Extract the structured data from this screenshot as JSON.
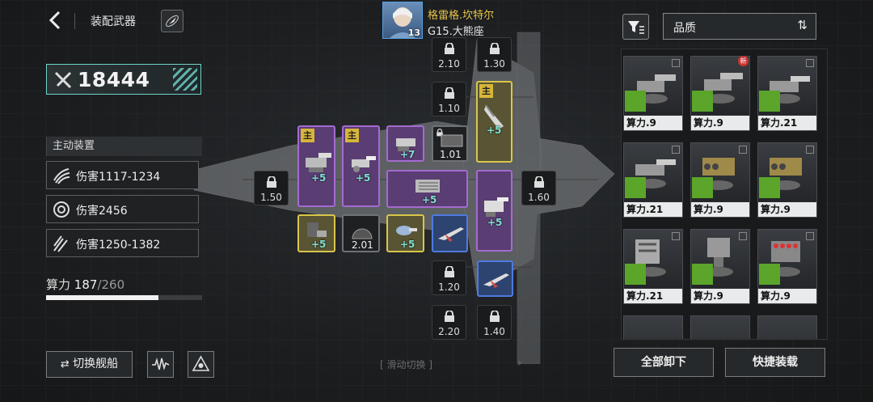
{
  "header": {
    "title": "装配武器",
    "pilot_name": "格雷格.坎特尔",
    "pilot_level": "13",
    "ship_name": "G15.大熊座"
  },
  "power": {
    "value": "18444"
  },
  "active_device": {
    "title": "主动装置",
    "stats": [
      "伤害1117-1234",
      "伤害2456",
      "伤害1250-1382"
    ]
  },
  "compute": {
    "label": "算力",
    "used": "187",
    "max": "/260",
    "fraction": 0.719
  },
  "buttons": {
    "switch_ship": "切换舰船",
    "unequip_all": "全部卸下",
    "quick_equip": "快捷装载",
    "swipe_hint": "滑动切换"
  },
  "filter": {
    "sort_label": "品质"
  },
  "slots": {
    "locked": [
      "2.10",
      "1.30",
      "1.10",
      "1.50",
      "1.60",
      "1.20",
      "2.20",
      "1.40"
    ],
    "main_tag": "主",
    "plus": "+5",
    "plus7": "+7",
    "num_101": "1.01",
    "num_201": "2.01"
  },
  "inventory": {
    "new_badge": "新",
    "cards": [
      "算力.9",
      "算力.9",
      "算力.21",
      "算力.21",
      "算力.9",
      "算力.9",
      "算力.21",
      "算力.9",
      "算力.9"
    ]
  }
}
